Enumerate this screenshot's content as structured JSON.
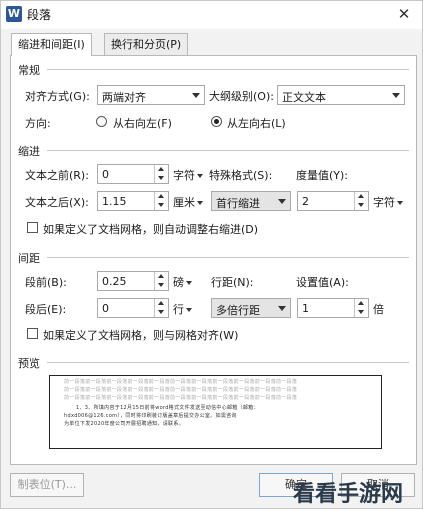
{
  "titlebar": {
    "app_icon": "W",
    "title": "段落",
    "close": "✕"
  },
  "tabs": [
    {
      "label": "缩进和间距(I)"
    },
    {
      "label": "换行和分页(P)"
    }
  ],
  "sections": {
    "general": "常规",
    "indent": "缩进",
    "spacing": "间距",
    "preview": "预览"
  },
  "general": {
    "align_label": "对齐方式(G):",
    "align_value": "两端对齐",
    "outline_label": "大纲级别(O):",
    "outline_value": "正文文本",
    "direction_label": "方向:",
    "rtl_label": "从右向左(F)",
    "ltr_label": "从左向右(L)",
    "selected_direction": "ltr"
  },
  "indent": {
    "before_label": "文本之前(R):",
    "before_value": "0",
    "before_unit": "字符",
    "after_label": "文本之后(X):",
    "after_value": "1.15",
    "after_unit": "厘米",
    "special_label": "特殊格式(S):",
    "special_value": "首行缩进",
    "measure_label": "度量值(Y):",
    "measure_value": "2",
    "measure_unit": "字符",
    "auto_adjust_label": "如果定义了文档网格，则自动调整右缩进(D)",
    "auto_adjust_checked": false
  },
  "spacing": {
    "before_label": "段前(B):",
    "before_value": "0.25",
    "before_unit": "磅",
    "after_label": "段后(E):",
    "after_value": "0",
    "after_unit": "行",
    "line_label": "行距(N):",
    "line_value": "多倍行距",
    "setting_label": "设置值(A):",
    "setting_value": "1",
    "setting_unit": "倍",
    "snap_grid_label": "如果定义了文档网格，则与网格对齐(W)",
    "snap_grid_checked": false
  },
  "preview": {
    "lines": [
      "前一段落前一段落前一段落前一段落前一段落前一段落前一段落前一段落前一段落前一段落前一段落",
      "前一段落前一段落前一段落前一段落前一段落前一段落前一段落前一段落前一段落前一段落前一段落",
      "前一段落前一段落前一段落前一段落前一段落前一段落前一段落前一段落前一段落前一段落前一段落",
      "1、3、所填内容于12月15日前将word格式文件发送至动信中心邮箱（邮箱：",
      "hdxd006@126.com），同时将印刷装订版盖章后提交办公室。如需咨询",
      "为单位下发2020年度公司开展招聘通知，请联系。"
    ]
  },
  "footer": {
    "tabs_button": "制表位(T)...",
    "ok_button": "确定",
    "cancel_button": "取消"
  },
  "watermark": "看看手游网",
  "colors": {
    "accent": "#2b579a"
  }
}
